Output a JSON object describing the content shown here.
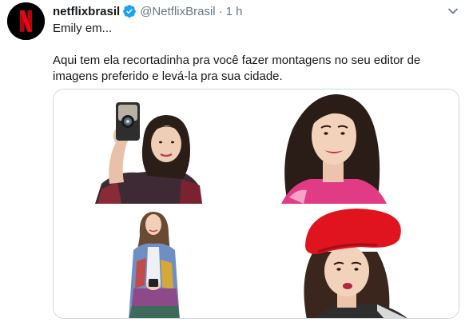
{
  "tweet": {
    "display_name": "netflixbrasil",
    "handle": "@NetflixBrasil",
    "separator": "·",
    "time": "1 h",
    "avatar_letter": "N",
    "line1": "Emily em...",
    "line2": "Aqui tem ela recortadinha pra você fazer montagens no seu editor de imagens preferido e levá-la pra sua cidade."
  },
  "colors": {
    "netflix_red": "#e50914",
    "verified_blue": "#1da1f2",
    "muted_text": "#657786",
    "border": "#ccd6dd"
  },
  "icons": {
    "verified": "verified-badge-icon",
    "more": "chevron-down-icon"
  },
  "media": {
    "images": [
      {
        "name": "emily-selfie-camera"
      },
      {
        "name": "emily-portrait-smile"
      },
      {
        "name": "emily-full-body-phone"
      },
      {
        "name": "emily-red-beret"
      }
    ]
  }
}
